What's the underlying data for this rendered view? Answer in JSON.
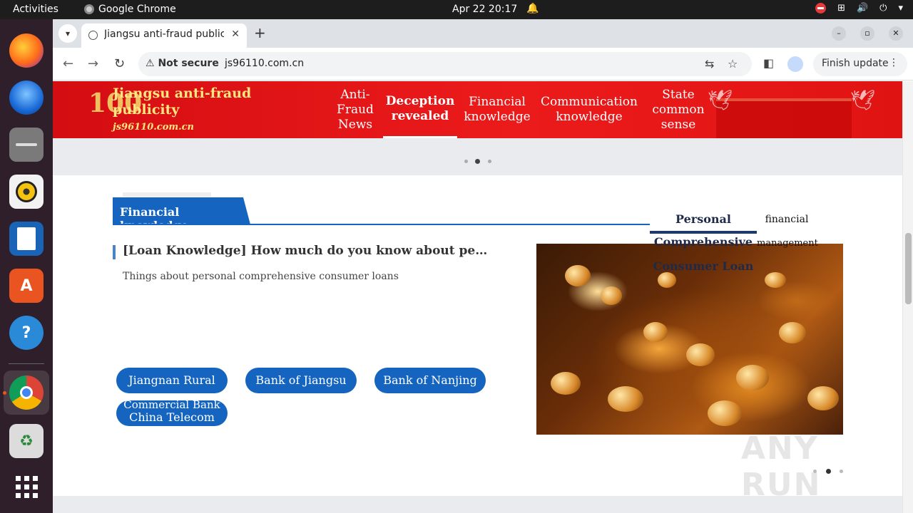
{
  "topbar": {
    "activities": "Activities",
    "app_name": "Google Chrome",
    "clock": "Apr 22  20:17",
    "bell_icon": "bell-icon"
  },
  "dock": {
    "items": [
      "firefox",
      "thunderbird",
      "files",
      "rhythmbox",
      "writer",
      "app-center",
      "help",
      "chrome",
      "trash",
      "show-apps"
    ]
  },
  "browser": {
    "tab_title": "Jiangsu anti-fraud publicity",
    "new_tab": "+",
    "security_label": "Not secure",
    "url": "js96110.com.cn",
    "update_label": "Finish update"
  },
  "banner": {
    "emblem_text": "100",
    "site_title": "Jiangsu anti-fraud publicity",
    "domain": "js96110.com.cn",
    "nav": [
      {
        "label": "Anti-Fraud News",
        "active": false
      },
      {
        "label": "Deception revealed",
        "active": true
      },
      {
        "label": "Financial knowledge",
        "active": false
      },
      {
        "label": "Communication knowledge",
        "active": false
      },
      {
        "label": "State common sense",
        "active": false
      }
    ]
  },
  "section": {
    "title": "Financial knowledge",
    "tabs": {
      "active_line1": "Personal",
      "active_line2": "Comprehensive",
      "active_line3": "Consumer Loan",
      "other_line1": "financial",
      "other_line2": "management"
    },
    "article": {
      "headline": "[Loan Knowledge] How much do you know about personal comprehensive consumer loans?",
      "summary": "Things about personal comprehensive consumer loans"
    },
    "banks": [
      "Jiangnan Rural",
      "Bank of Jiangsu",
      "Bank of Nanjing",
      "China Telecom"
    ],
    "bank_overlap_text": "Commercial Bank"
  },
  "watermark": "ANY RUN",
  "colors": {
    "accent_blue": "#1565c0",
    "banner_red": "#e01313",
    "banner_gold": "#ffe680"
  }
}
